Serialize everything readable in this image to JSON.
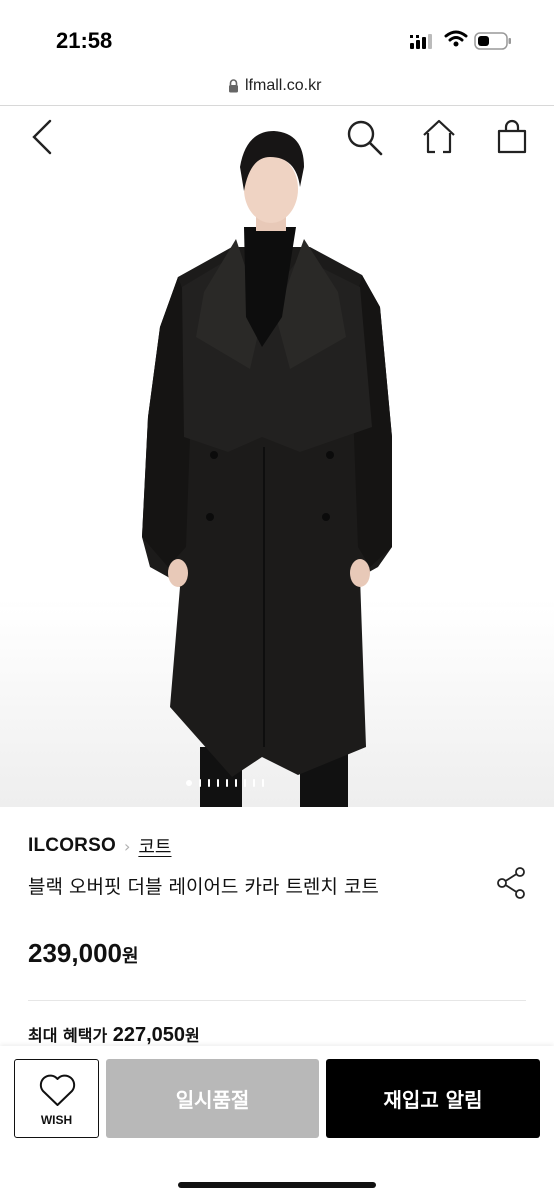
{
  "status_bar": {
    "time": "21:58"
  },
  "browser": {
    "url": "lfmall.co.kr"
  },
  "product": {
    "brand": "ILCORSO",
    "category": "코트",
    "title": "블랙 오버핏 더블 레이어드 카라 트렌치 코트",
    "price": "239,000",
    "price_unit": "원",
    "benefit_label": "최대 혜택가",
    "benefit_price": "227,050",
    "benefit_unit": "원"
  },
  "gallery": {
    "total_images": 9,
    "current_index": 1
  },
  "actions": {
    "wish_label": "WISH",
    "soldout_label": "일시품절",
    "restock_label": "재입고 알림"
  },
  "icons": [
    "back-icon",
    "search-icon",
    "home-icon",
    "shopping-bag-icon",
    "share-icon",
    "heart-icon",
    "lock-icon",
    "signal-icon",
    "wifi-icon",
    "battery-icon"
  ]
}
